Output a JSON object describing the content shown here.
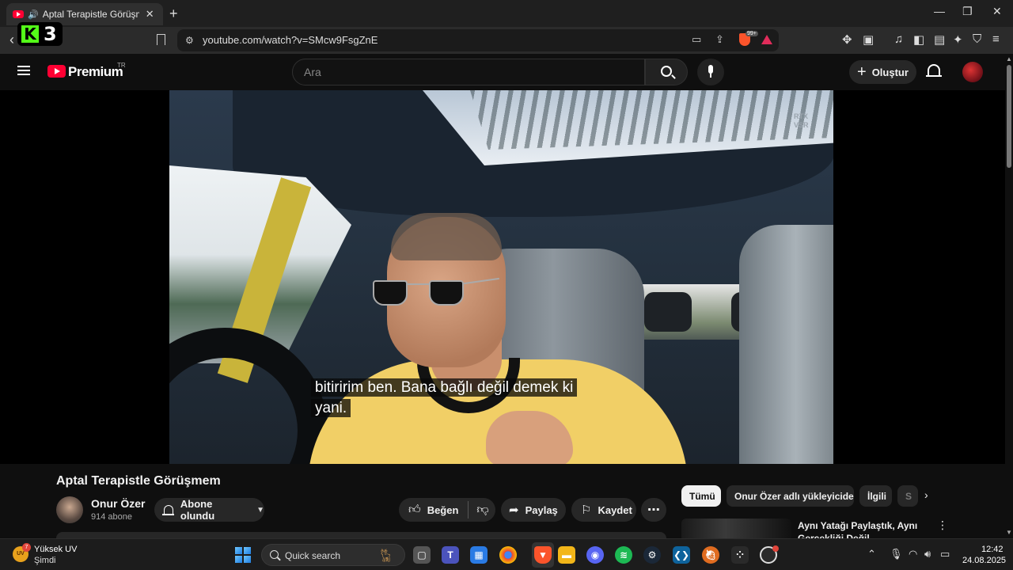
{
  "browser": {
    "tab_title": "Aptal Terapistle Görüşmem -",
    "url": "youtube.com/watch?v=SMcw9FsgZnE",
    "shield_badge": "99+",
    "overlay_logo_letter": "K",
    "overlay_logo_number": "3"
  },
  "youtube": {
    "brand": "Premium",
    "region": "TR",
    "search_placeholder": "Ara",
    "create_label": "Oluştur",
    "video": {
      "watermark_line1": "RTX",
      "watermark_line2": "VSR",
      "subtitle_line1": "bitiririm ben. Bana bağlı değil demek ki",
      "subtitle_line2": "yani.",
      "title": "Aptal Terapistle Görüşmem"
    },
    "channel": {
      "name": "Onur Özer",
      "subscribers": "914 abone",
      "subscribe_label": "Abone olundu"
    },
    "actions": {
      "like_label": "Beğen",
      "share_label": "Paylaş",
      "save_label": "Kaydet"
    },
    "chips": [
      "Tümü",
      "Onur Özer adlı yükleyiciden",
      "İlgili",
      "S"
    ],
    "recommendation": {
      "title": "Aynı Yatağı Paylaştık, Aynı Gerçekliği Değil"
    }
  },
  "taskbar": {
    "weather_title": "Yüksek UV",
    "weather_sub": "Şimdi",
    "uv_label": "UV",
    "uv_badge": "7",
    "search_label": "Quick search",
    "time": "12:42",
    "date": "24.08.2025"
  },
  "colors": {
    "yt_red": "#ff0033",
    "kick_green": "#53fc18",
    "brave_orange": "#fb542b"
  }
}
